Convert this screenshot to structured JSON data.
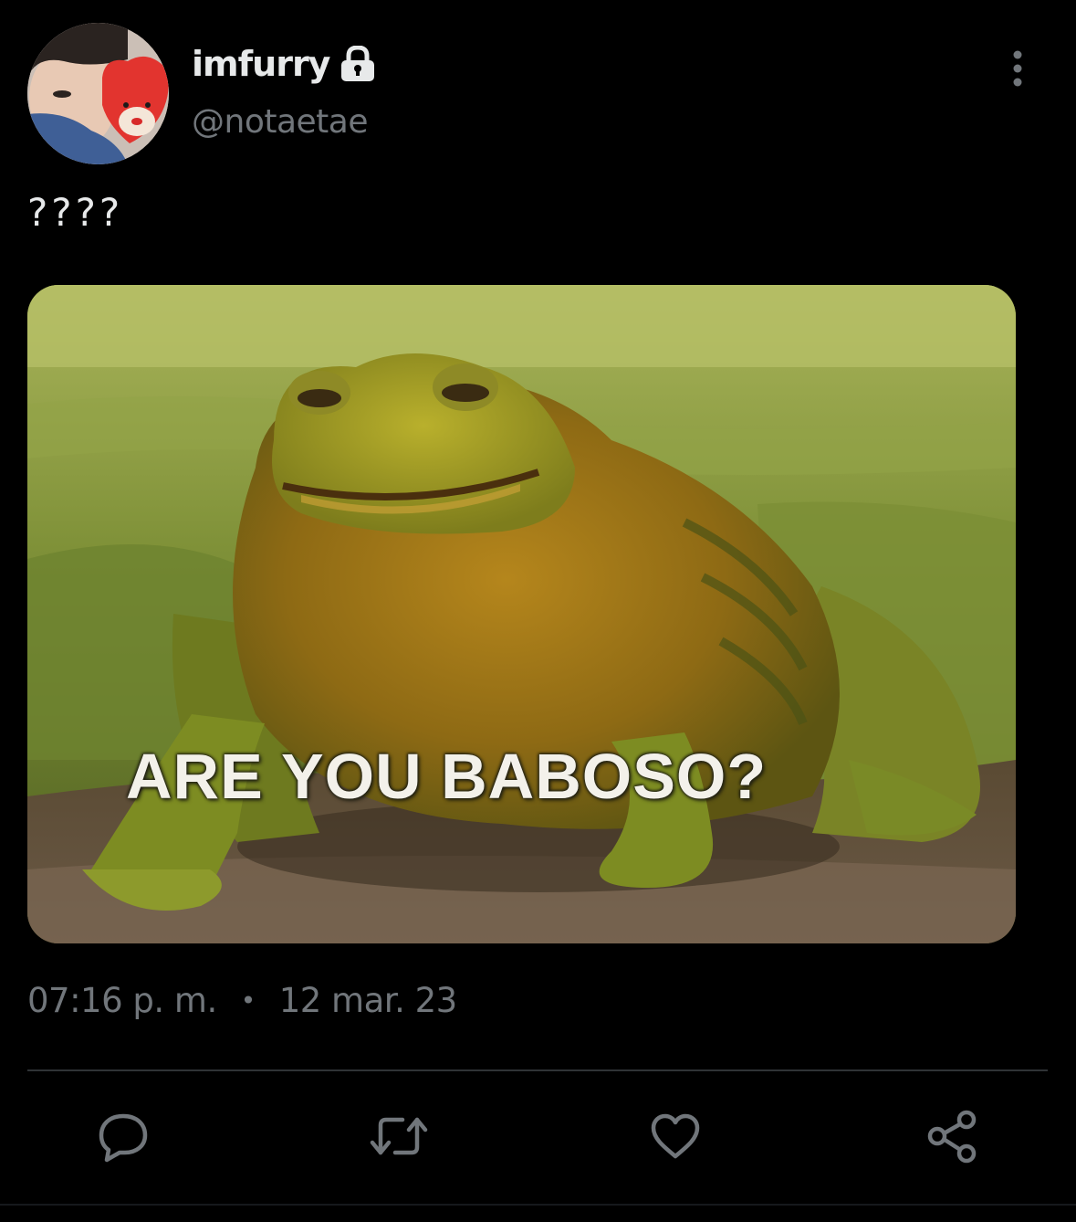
{
  "author": {
    "display_name": "imfurry",
    "handle": "@notaetae",
    "protected_icon": "lock-icon",
    "avatar_icon": "avatar"
  },
  "tweet": {
    "text": "????",
    "media": {
      "caption": "ARE YOU BABOSO?"
    },
    "time": "07:16 p. m.",
    "separator": "•",
    "date": "12 mar. 23"
  },
  "actions": [
    {
      "name": "reply",
      "icon": "reply-icon"
    },
    {
      "name": "retweet",
      "icon": "retweet-icon"
    },
    {
      "name": "like",
      "icon": "heart-icon"
    },
    {
      "name": "share",
      "icon": "share-icon"
    }
  ],
  "colors": {
    "background": "#000000",
    "primary_text": "#e7e9ea",
    "secondary_text": "#71767b",
    "divider": "#2f3336",
    "icon": "#71767b"
  }
}
